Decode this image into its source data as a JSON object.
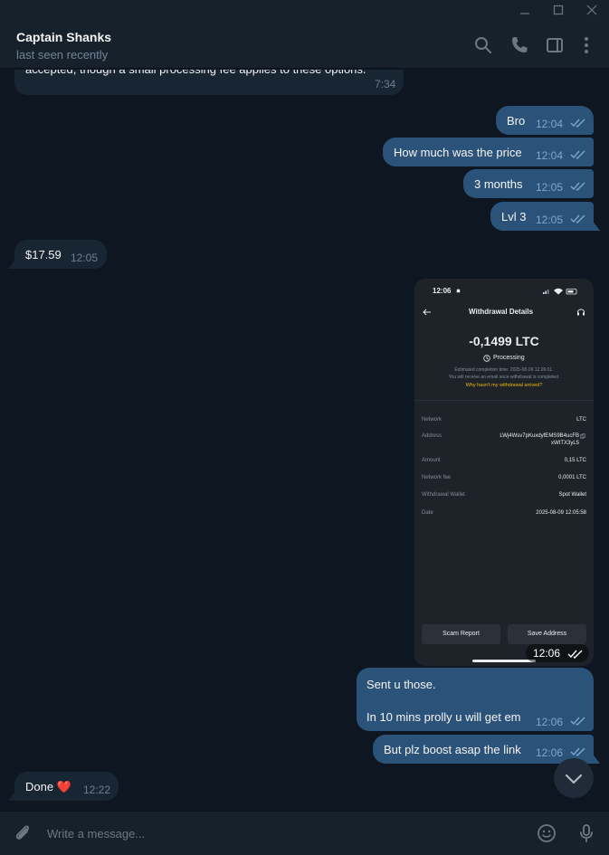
{
  "chat": {
    "name": "Captain Shanks",
    "status": "last seen recently"
  },
  "messages": {
    "partial": {
      "text": "accepted, though a small processing fee applies to these options.",
      "time": "7:34"
    },
    "m1": {
      "text": "Bro",
      "time": "12:04"
    },
    "m2": {
      "text": "How much was the price",
      "time": "12:04"
    },
    "m3": {
      "text": "3 months",
      "time": "12:05"
    },
    "m4": {
      "text": "Lvl 3",
      "time": "12:05"
    },
    "m5": {
      "text": "$17.59",
      "time": "12:05"
    },
    "photo_time": "12:06",
    "m6": {
      "line1": "Sent u those.",
      "line2": "In 10 mins prolly u will get em",
      "time": "12:06"
    },
    "m7": {
      "text": "But plz boost asap the link",
      "time": "12:06"
    },
    "m8": {
      "text": "Done",
      "emoji": "❤️",
      "time": "12:22"
    }
  },
  "screenshot": {
    "status_time": "12:06",
    "title": "Withdrawal Details",
    "amount": "-0,1499 LTC",
    "status": "Processing",
    "eta": "Estimated completion time: 2025-08-09 12:26:01.",
    "email_note": "You will receive an email once withdrawal is completed.",
    "help_link": "Why hasn't my withdrawal arrived?",
    "rows": [
      {
        "label": "Network",
        "value": "LTC"
      },
      {
        "label": "Address",
        "value": "LWj4Wsv7pKuxdyfEMS9B4ucFB",
        "value2": "xWtTX3yL5"
      },
      {
        "label": "Amount",
        "value": "0,15 LTC"
      },
      {
        "label": "Network fee",
        "value": "0,0001 LTC"
      },
      {
        "label": "Withdrawal Wallet",
        "value": "Spot Wallet"
      },
      {
        "label": "Date",
        "value": "2025-08-09 12:05:58"
      }
    ],
    "buttons": {
      "scam": "Scam Report",
      "save": "Save Address"
    }
  },
  "composer": {
    "placeholder": "Write a message..."
  },
  "icons": {
    "search": "search-icon",
    "call": "phone-icon",
    "sidebar": "sidebar-toggle-icon",
    "more": "more-vertical-icon",
    "attach": "paperclip-icon",
    "emoji": "emoji-icon",
    "mic": "microphone-icon",
    "scroll": "chevron-down-icon"
  },
  "colors": {
    "background": "#0e1621",
    "outgoing": "#2b5278",
    "incoming": "#182533",
    "header": "#17212b",
    "link": "#f0b90b"
  }
}
